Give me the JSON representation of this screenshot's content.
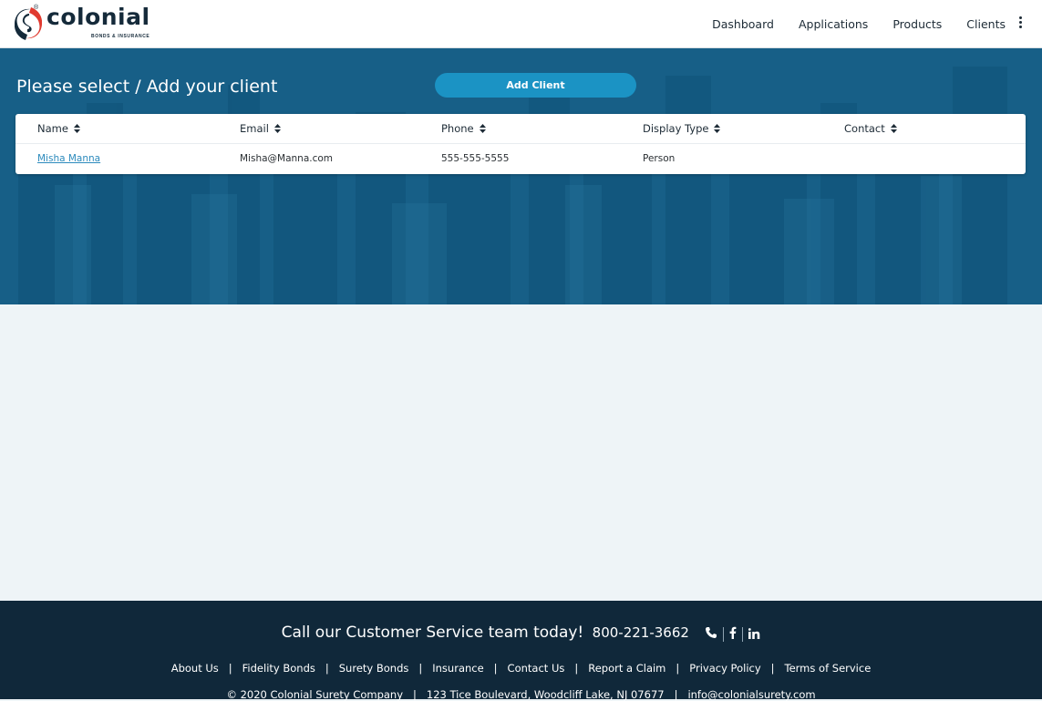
{
  "brand": {
    "name": "colonial",
    "tagline": "BONDS & INSURANCE",
    "registered_mark": "®",
    "colors": {
      "navy": "#152a3a",
      "red": "#e03a2f",
      "accent": "#1b93c4",
      "hero": "#175f87",
      "footer": "#10283a"
    }
  },
  "nav": {
    "items": [
      "Dashboard",
      "Applications",
      "Products",
      "Clients"
    ],
    "more_icon": "kebab-menu-icon"
  },
  "hero": {
    "title": "Please select / Add your client",
    "add_button": "Add Client"
  },
  "table": {
    "columns": [
      "Name",
      "Email",
      "Phone",
      "Display Type",
      "Contact"
    ],
    "sort_icon": "sort-icon",
    "rows": [
      {
        "name": "Misha Manna",
        "email": "Misha@Manna.com",
        "phone": "555-555-5555",
        "display_type": "Person",
        "contact": ""
      }
    ]
  },
  "footer": {
    "cs_text": "Call our Customer Service team today!",
    "cs_phone": "800-221-3662",
    "social_icons": [
      "phone-icon",
      "facebook-icon",
      "linkedin-icon"
    ],
    "links": [
      "About Us",
      "Fidelity Bonds",
      "Surety Bonds",
      "Insurance",
      "Contact Us",
      "Report a Claim",
      "Privacy Policy",
      "Terms of Service"
    ],
    "copyright": "© 2020 Colonial Surety Company",
    "address": "123 Tice Boulevard, Woodcliff Lake, NJ 07677",
    "email": "info@colonialsurety.com",
    "separator": "|"
  }
}
